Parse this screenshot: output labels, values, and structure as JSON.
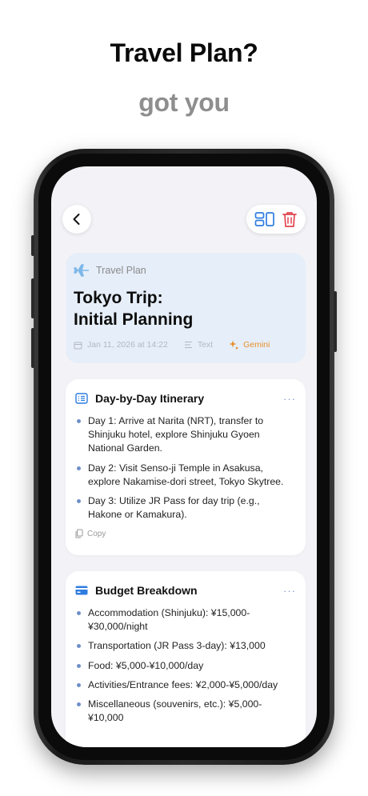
{
  "promo": {
    "headline": "Travel Plan?",
    "subline": "got you"
  },
  "note": {
    "category": "Travel Plan",
    "title_line1": "Tokyo Trip:",
    "title_line2": "Initial Planning",
    "date": "Jan 11, 2026 at 14:22",
    "type": "Text",
    "source": "Gemini"
  },
  "sections": [
    {
      "title": "Day-by-Day Itinerary",
      "items": [
        "Day 1: Arrive at Narita (NRT), transfer to Shinjuku hotel, explore Shinjuku Gyoen National Garden.",
        "Day 2: Visit Senso-ji Temple in Asakusa, explore Nakamise-dori street, Tokyo Skytree.",
        "Day 3: Utilize JR Pass for day trip (e.g., Hakone or Kamakura)."
      ],
      "copy_label": "Copy"
    },
    {
      "title": "Budget Breakdown",
      "items": [
        "Accommodation (Shinjuku): ¥15,000-¥30,000/night",
        "Transportation (JR Pass 3-day): ¥13,000",
        "Food: ¥5,000-¥10,000/day",
        "Activities/Entrance fees: ¥2,000-¥5,000/day",
        "Miscellaneous (souvenirs, etc.): ¥5,000-¥10,000"
      ]
    }
  ],
  "colors": {
    "accent_blue": "#2f7de1",
    "delete_red": "#e0444f",
    "gemini_orange": "#e8902c",
    "header_card_bg": "#e6eef9"
  },
  "icons": {
    "back": "chevron-left-icon",
    "layout": "layout-icon",
    "delete": "trash-icon",
    "category": "airplane-icon",
    "date": "calendar-icon",
    "type": "text-lines-icon",
    "source": "sparkle-icon",
    "itinerary": "list-icon",
    "budget": "credit-card-icon",
    "copy": "copy-icon"
  }
}
